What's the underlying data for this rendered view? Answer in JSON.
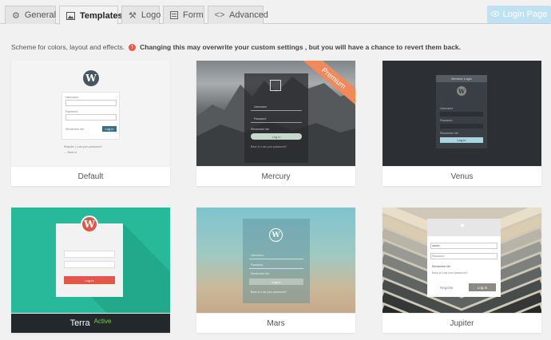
{
  "tabs": [
    {
      "label": "General",
      "icon": "gear-icon"
    },
    {
      "label": "Templates",
      "icon": "image-icon"
    },
    {
      "label": "Logo",
      "icon": "hammer-icon"
    },
    {
      "label": "Form",
      "icon": "form-icon"
    },
    {
      "label": "Advanced",
      "icon": "code-icon"
    }
  ],
  "login_page_label": "Login Page",
  "description": {
    "text": "Scheme for colors, layout and effects.",
    "warning": "Changing this may overwrite your custom settings , but you will have a chance to revert them back."
  },
  "templates": [
    {
      "name": "Default"
    },
    {
      "name": "Mercury",
      "badge": "Premium"
    },
    {
      "name": "Venus"
    },
    {
      "name": "Terra",
      "status": "Active"
    },
    {
      "name": "Mars"
    },
    {
      "name": "Jupiter"
    }
  ],
  "previews": {
    "default": {
      "username": "Username",
      "password": "Password",
      "remember": "Remember Me",
      "login": "Log in",
      "links": "Register | Lost your password?",
      "back": "← Back to"
    },
    "mercury": {
      "username": "Username",
      "password": "Password",
      "remember": "Remember Me",
      "login": "Log in",
      "links": "Back to  Lost your password?"
    },
    "venus": {
      "header": "Member Login",
      "username": "Username",
      "password": "Password",
      "remember": "Remember Me",
      "login": "Log in"
    },
    "terra": {
      "login": "Log in"
    },
    "mars": {
      "username": "Username",
      "password": "Password",
      "remember": "Remember Me",
      "login": "Log in",
      "links": "Back to  Lost your password?"
    },
    "jupiter": {
      "username": "admin",
      "password": "Password",
      "remember": "Remember Me",
      "links": "Back to  Lost your password?",
      "register": "Register",
      "login": "Log in"
    }
  },
  "colors": {
    "accent_blue": "#bfe2f2",
    "warning_red": "#e25b4b",
    "active_green": "#7ad03a",
    "terra_bg": "#27b99a",
    "premium_ribbon": "#f08a5d"
  }
}
